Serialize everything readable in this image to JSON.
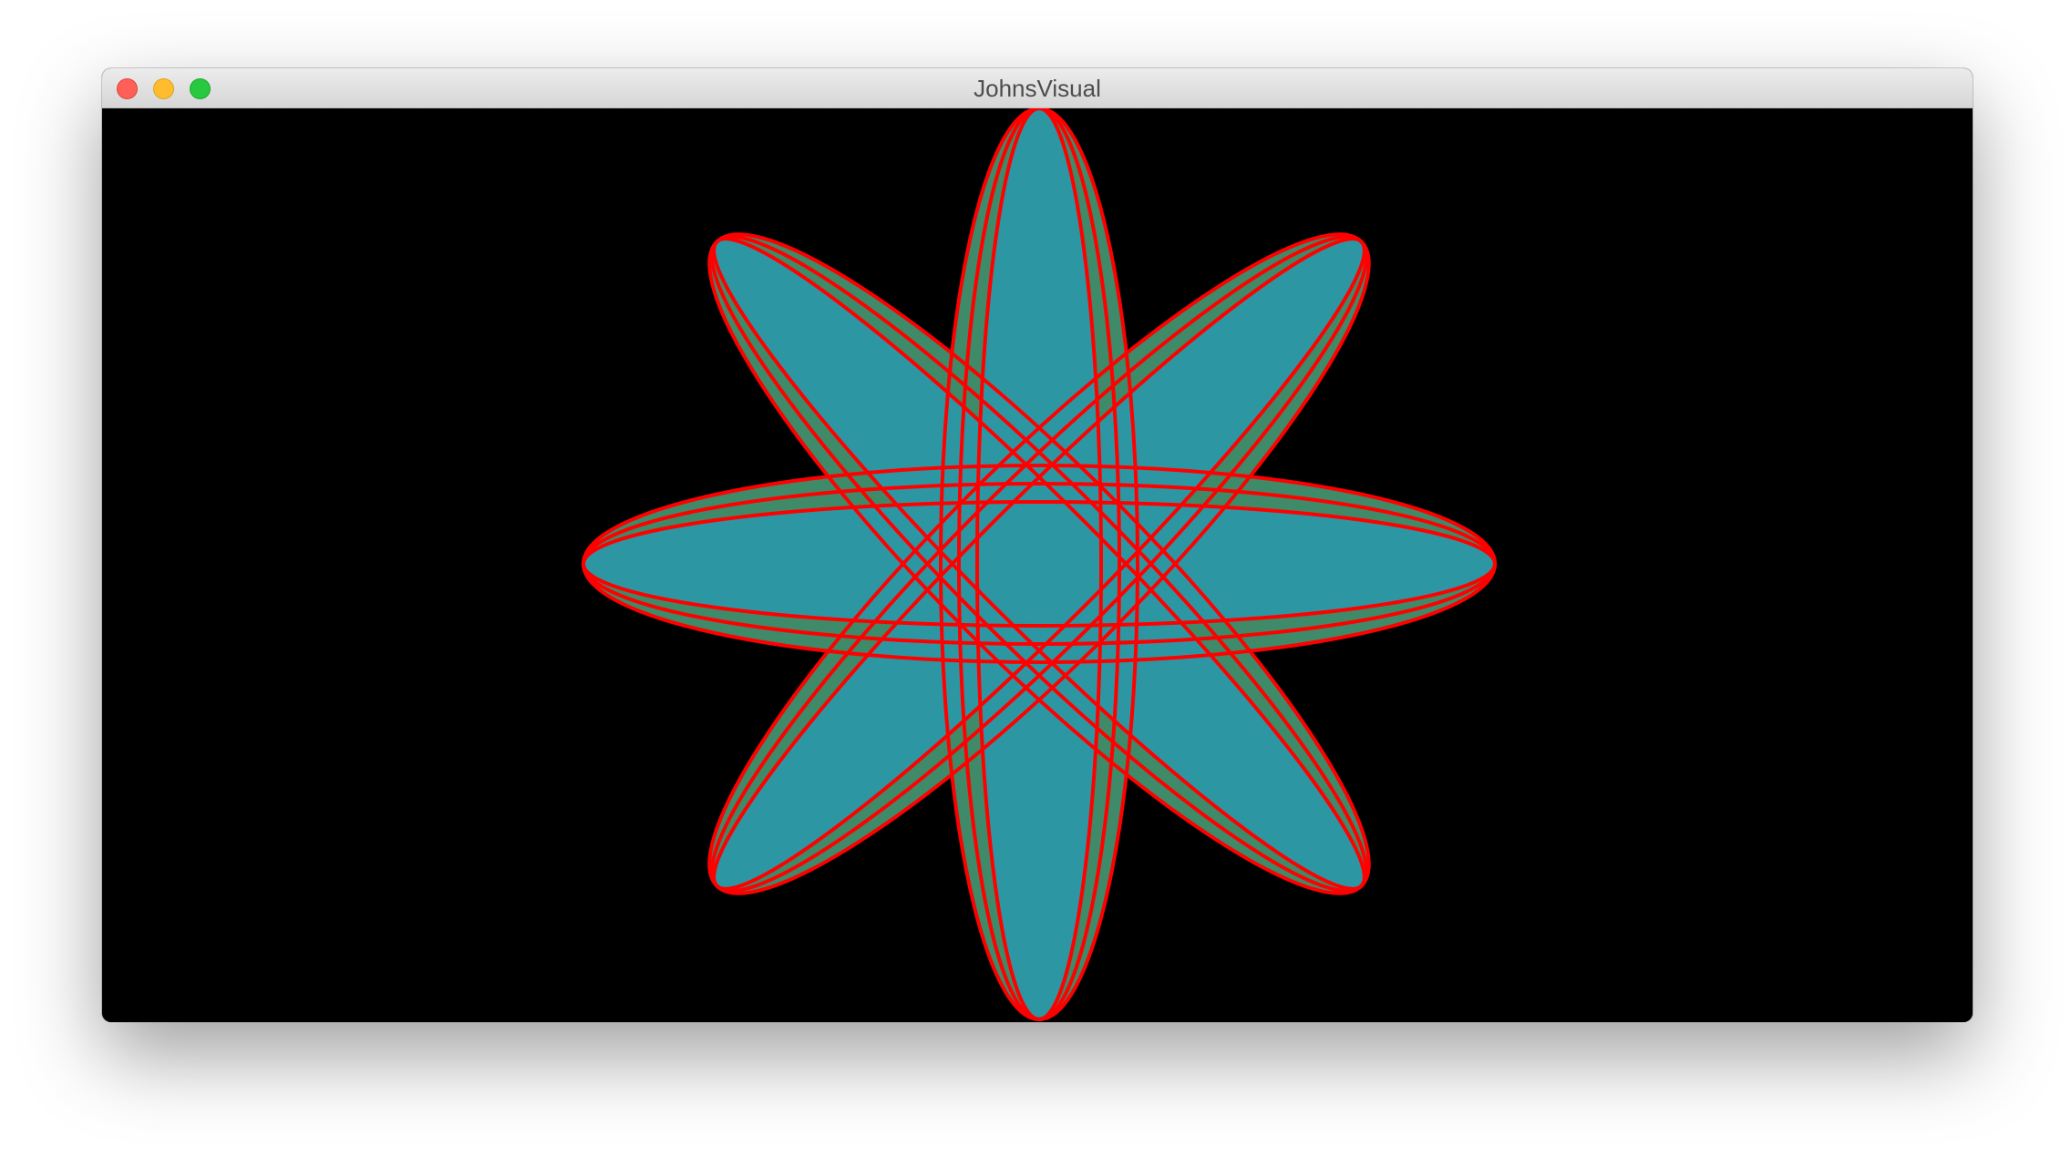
{
  "window": {
    "title": "JohnsVisual"
  },
  "colors": {
    "background": "#000000",
    "petal_fill": "#2c97a3",
    "overlap_fill": "#3f8a68",
    "outline": "#ff0000"
  },
  "petals": {
    "count": 8,
    "rings_per_petal": 3
  }
}
